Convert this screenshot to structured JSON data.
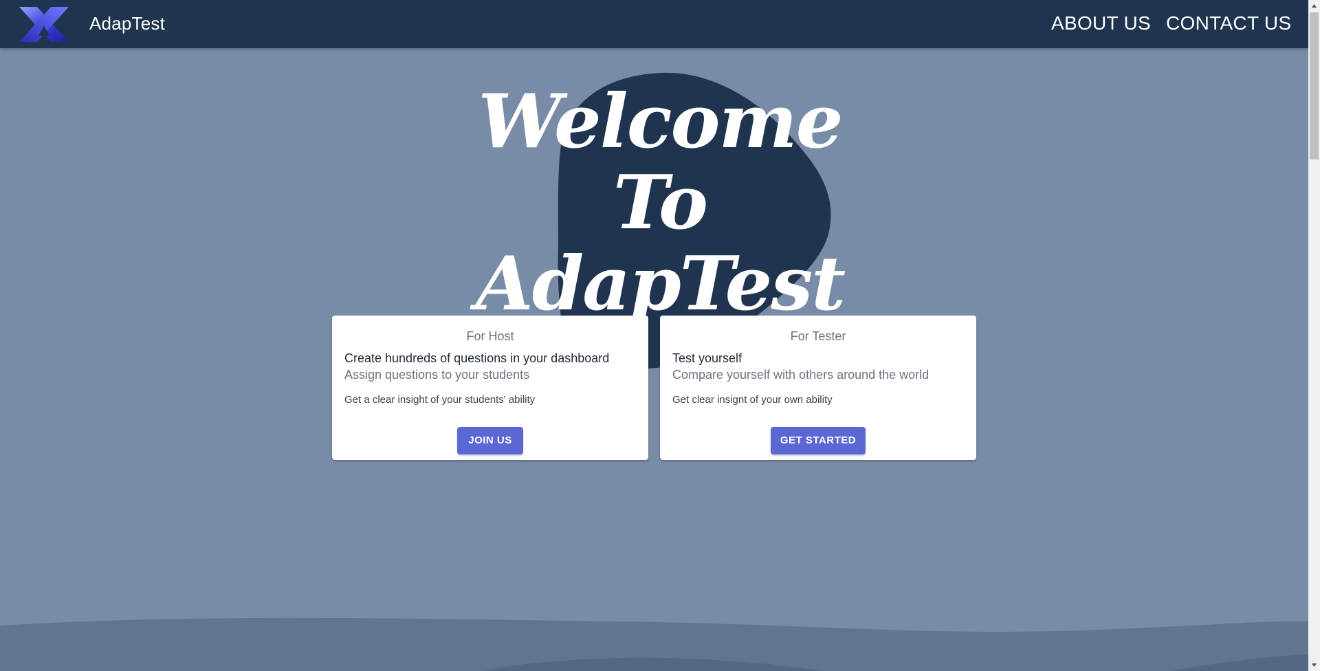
{
  "header": {
    "brand": "AdapTest",
    "nav": {
      "about": "ABOUT US",
      "contact": "CONTACT US"
    }
  },
  "hero": {
    "line1": "Welcome To",
    "line2": "AdapTest"
  },
  "cards": {
    "host": {
      "kicker": "For Host",
      "heading": "Create hundreds of questions in your dashboard",
      "sub": "Assign questions to your students",
      "body": "Get a clear insight of your students' ability",
      "button": "JOIN US"
    },
    "tester": {
      "kicker": "For Tester",
      "heading": "Test yourself",
      "sub": "Compare yourself with others around the world",
      "body": "Get clear insignt of your own ability",
      "button": "GET STARTED"
    }
  },
  "colors": {
    "header_bg": "#1f344f",
    "page_bg": "#788ca8",
    "accent": "#5c67d6",
    "blob": "#1f344f"
  }
}
